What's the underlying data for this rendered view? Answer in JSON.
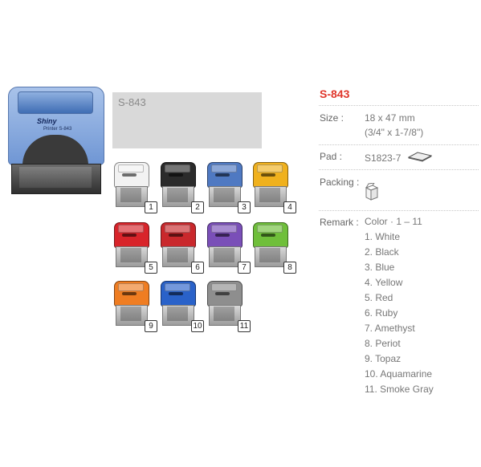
{
  "product": {
    "model": "S-843",
    "plate_label": "S-843",
    "stamp_logo": "Shiny",
    "stamp_model_text": "Printer S-843"
  },
  "specs": {
    "size_label": "Size :",
    "size_value": "18 x 47 mm",
    "size_value_imperial": "(3/4\" x 1-7/8\")",
    "pad_label": "Pad :",
    "pad_value": "S1823-7",
    "packing_label": "Packing :",
    "remark_label": "Remark :",
    "remark_heading": "Color · 1 – 11",
    "colors": [
      "1. White",
      "2. Black",
      "3. Blue",
      "4. Yellow",
      "5. Red",
      "6. Ruby",
      "7. Amethyst",
      "8. Periot",
      "9. Topaz",
      "10. Aquamarine",
      "11. Smoke Gray"
    ]
  },
  "variants": [
    {
      "num": "1",
      "color": "#f2f2f2"
    },
    {
      "num": "2",
      "color": "#2b2b2b"
    },
    {
      "num": "3",
      "color": "#4f79c2"
    },
    {
      "num": "4",
      "color": "#f0b11d"
    },
    {
      "num": "5",
      "color": "#d8242a"
    },
    {
      "num": "6",
      "color": "#c9282c"
    },
    {
      "num": "7",
      "color": "#7a4fb8"
    },
    {
      "num": "8",
      "color": "#6fbf3a"
    },
    {
      "num": "9",
      "color": "#ef7d22"
    },
    {
      "num": "10",
      "color": "#2a62c9"
    },
    {
      "num": "11",
      "color": "#8e8e8e"
    }
  ]
}
